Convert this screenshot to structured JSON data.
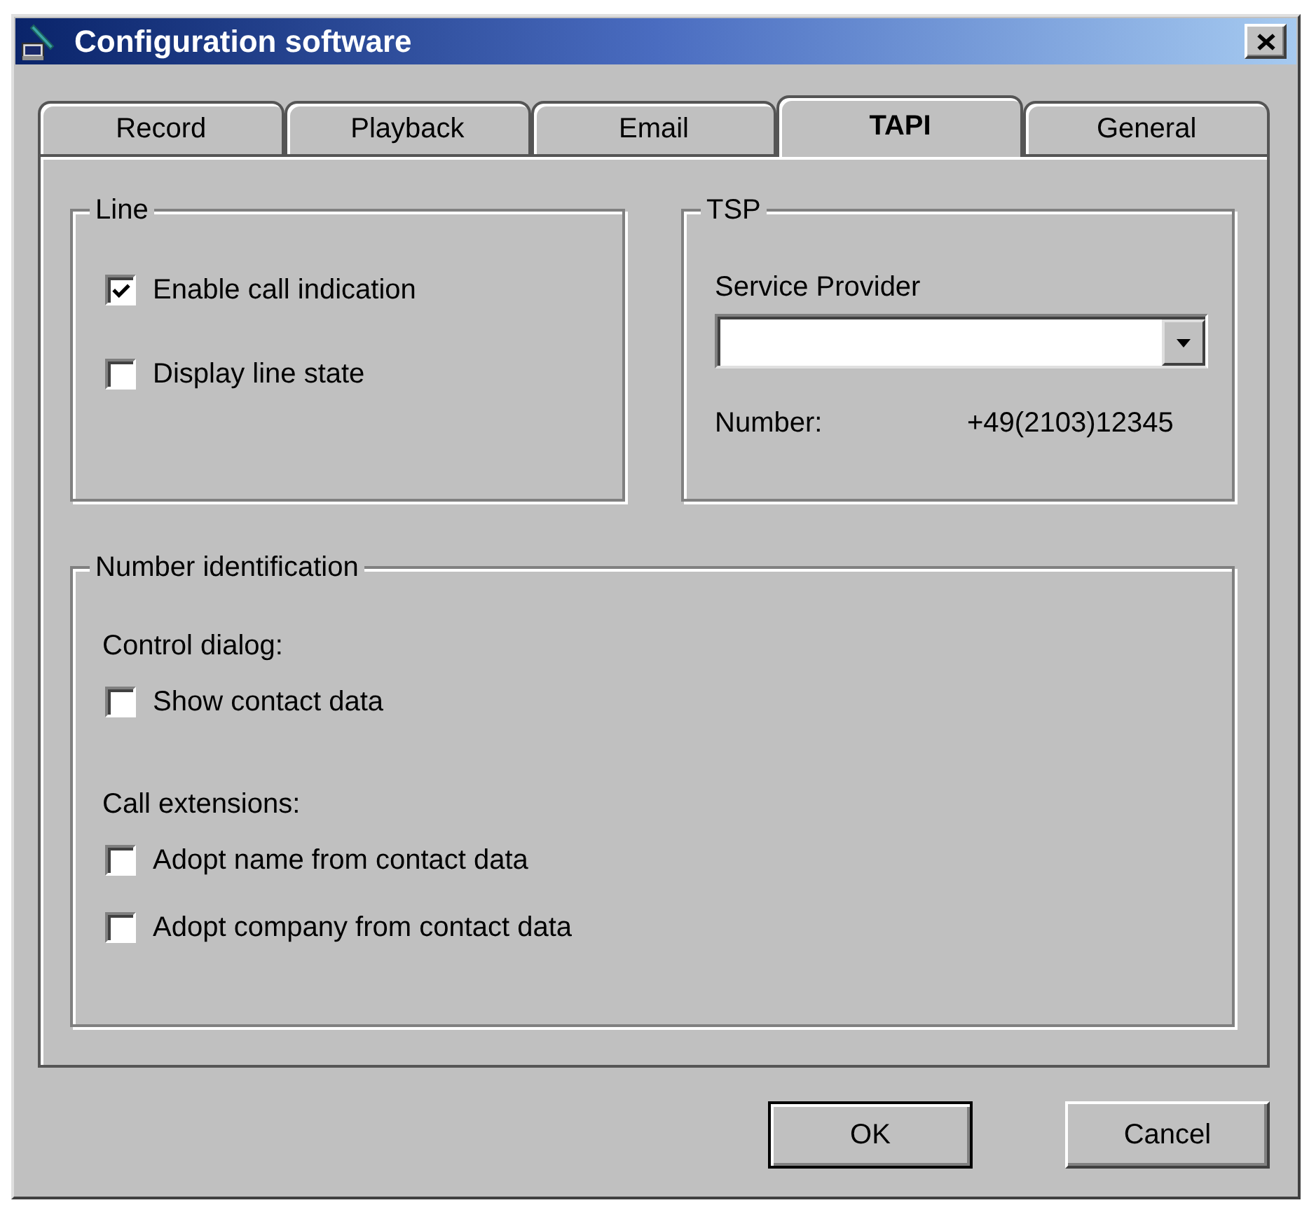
{
  "window": {
    "title": "Configuration software"
  },
  "tabs": [
    {
      "label": "Record",
      "selected": false
    },
    {
      "label": "Playback",
      "selected": false
    },
    {
      "label": "Email",
      "selected": false
    },
    {
      "label": "TAPI",
      "selected": true
    },
    {
      "label": "General",
      "selected": false
    }
  ],
  "line_group": {
    "title": "Line",
    "options": [
      {
        "label": "Enable call indication",
        "checked": true
      },
      {
        "label": "Display line state",
        "checked": false
      }
    ]
  },
  "tsp_group": {
    "title": "TSP",
    "service_provider": {
      "label": "Service Provider"
    },
    "number": {
      "label": "Number:",
      "value": "+49(2103)12345"
    }
  },
  "number_identification": {
    "title": "Number identification",
    "sections": [
      {
        "heading": "Control dialog:",
        "options": [
          {
            "label": "Show contact data",
            "checked": false
          }
        ]
      },
      {
        "heading": "Call extensions:",
        "options": [
          {
            "label": "Adopt name from contact data",
            "checked": false
          },
          {
            "label": "Adopt company from contact data",
            "checked": false
          }
        ]
      }
    ]
  },
  "buttons": [
    {
      "label": "OK",
      "default": true
    },
    {
      "label": "Cancel",
      "default": false
    }
  ]
}
